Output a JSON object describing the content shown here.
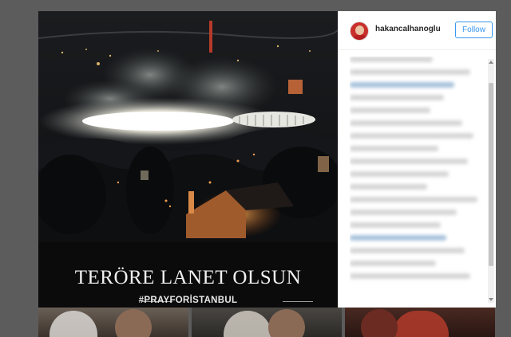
{
  "post": {
    "image_title": "TERÖRE LANET OLSUN",
    "image_hashtag": "#PRAYFORİSTANBUL"
  },
  "sidebar": {
    "username": "hakancalhanoglu",
    "follow_label": "Follow"
  },
  "colors": {
    "follow_blue": "#3897f0",
    "overlay": "#5c5c5c",
    "stadium_light": "#f4f1e4",
    "fire": "#e48a3a"
  }
}
